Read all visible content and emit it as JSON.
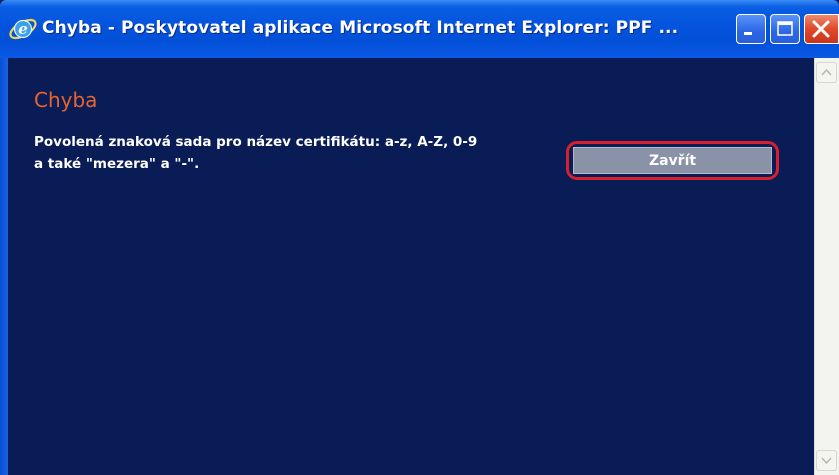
{
  "window": {
    "title": "Chyba - Poskytovatel aplikace Microsoft Internet Explorer: PPF ..."
  },
  "dialog": {
    "heading": "Chyba",
    "message_line1": "Povolená znaková sada pro název certifikátu: a-z, A-Z, 0-9",
    "message_line2": "a také \"mezera\" a \"-\".",
    "close_button": "Zavřít"
  },
  "colors": {
    "background": "#0a1c56",
    "heading": "#e8642e",
    "button_highlight": "#d8202c",
    "titlebar": "#0453dd"
  },
  "icons": {
    "app": "internet-explorer-icon",
    "minimize": "minimize-icon",
    "maximize": "maximize-icon",
    "close": "close-icon",
    "scroll_up": "chevron-up-icon",
    "scroll_down": "chevron-down-icon"
  }
}
